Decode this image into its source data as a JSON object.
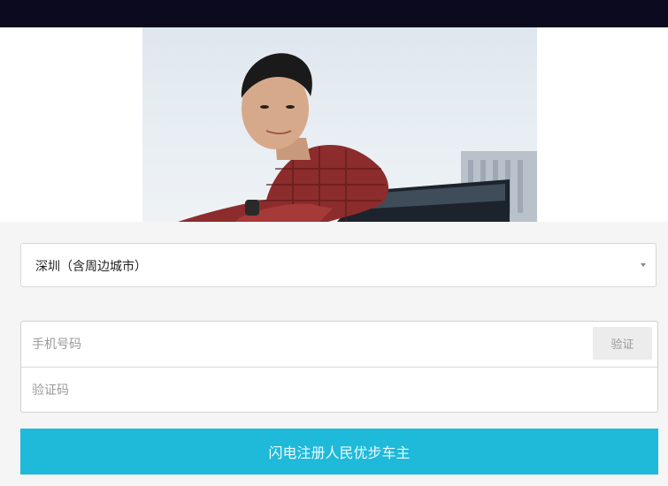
{
  "hero": {
    "image": "man-leaning-on-car-photo"
  },
  "form": {
    "city_select": {
      "value": "深圳（含周边城市）",
      "icon": "caret-down-icon"
    },
    "phone": {
      "placeholder": "手机号码",
      "verify_label": "验证"
    },
    "code": {
      "placeholder": "验证码"
    },
    "submit_label": "闪电注册人民优步车主"
  },
  "colors": {
    "topbar": "#0b0a1e",
    "submit": "#1fb9d9",
    "background": "#f5f5f5"
  }
}
